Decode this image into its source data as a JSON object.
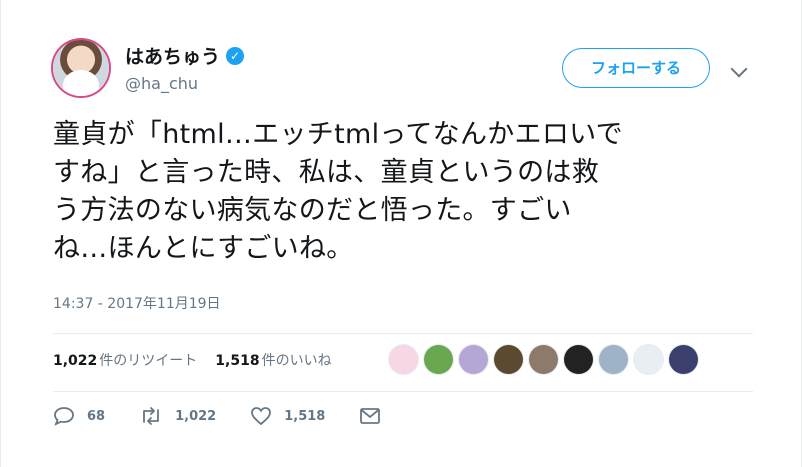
{
  "tweet": {
    "display_name": "はあちゅう",
    "handle": "@ha_chu",
    "follow_label": "フォローする",
    "text": "童貞が「html…エッチtmlってなんかエロいで\nすね」と言った時、私は、童貞というのは救\nう方法のない病気なのだと悟った。すごい\nね…ほんとにすごいね。",
    "timestamp": "14:37 - 2017年11月19日",
    "retweet_count": "1,022",
    "retweet_label": "件のリツイート",
    "like_count": "1,518",
    "like_label": "件のいいね",
    "reply_action_count": "68",
    "retweet_action_count": "1,022",
    "like_action_count": "1,518"
  },
  "likers": [
    "#f7d6e6",
    "#6aa84f",
    "#b4a7d6",
    "#5b4a2f",
    "#8e7a6b",
    "#222222",
    "#9fb3c8",
    "#e9eef3",
    "#3b3f6e"
  ],
  "icons": [
    "verified-icon",
    "chevron-down-icon",
    "reply-icon",
    "retweet-icon",
    "like-icon",
    "message-icon"
  ]
}
